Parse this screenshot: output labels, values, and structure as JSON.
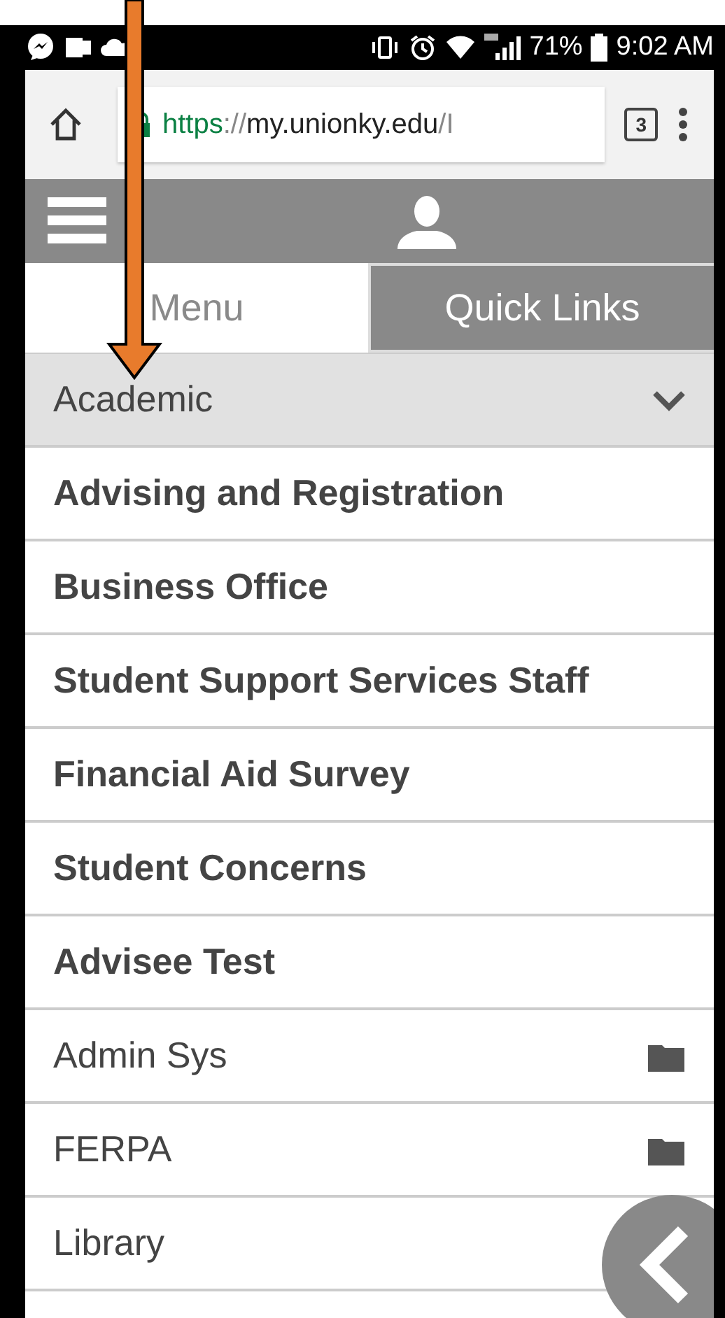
{
  "status_bar": {
    "battery": "71%",
    "time": "9:02 AM"
  },
  "browser": {
    "url": {
      "scheme": "https",
      "separator": "://",
      "host": "my.unionky.edu",
      "path": "/I"
    },
    "tab_count": "3"
  },
  "tabs": [
    {
      "label": "Menu",
      "selected": true
    },
    {
      "label": "Quick Links",
      "selected": false
    }
  ],
  "items": [
    {
      "kind": "category",
      "label": "Academic",
      "expanded": true
    },
    {
      "kind": "link",
      "label": "Advising and Registration"
    },
    {
      "kind": "link",
      "label": "Business Office"
    },
    {
      "kind": "link",
      "label": "Student Support Services Staff"
    },
    {
      "kind": "link",
      "label": "Financial Aid Survey"
    },
    {
      "kind": "link",
      "label": "Student Concerns"
    },
    {
      "kind": "link",
      "label": "Advisee Test"
    },
    {
      "kind": "folder",
      "label": "Admin Sys"
    },
    {
      "kind": "folder",
      "label": "FERPA"
    },
    {
      "kind": "plain",
      "label": "Library"
    }
  ]
}
